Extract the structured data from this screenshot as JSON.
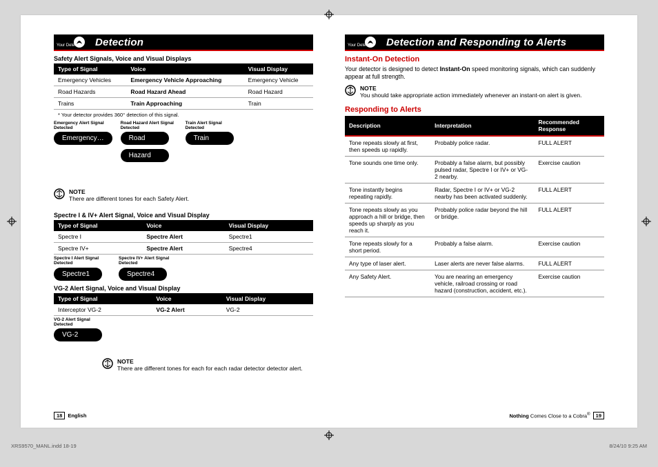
{
  "left": {
    "your_detector": "Your Detector",
    "title": "Detection",
    "t1_caption": "Safety Alert Signals, Voice and Visual Displays",
    "th": {
      "signal": "Type of Signal",
      "voice": "Voice",
      "visual": "Visual Display"
    },
    "t1": [
      {
        "signal": "Emergency Vehicles",
        "voice": "Emergency Vehicle Approaching",
        "visual": "Emergency Vehicle"
      },
      {
        "signal": "Road Hazards",
        "voice": "Road Hazard Ahead",
        "visual": "Road Hazard"
      },
      {
        "signal": "Trains",
        "voice": "Train Approaching",
        "visual": "Train"
      }
    ],
    "t1_foot": "* Your detector provides 360° detection of this signal.",
    "chips1": [
      {
        "label": "Emergency Alert Signal Detected",
        "chips": [
          "Emergency…"
        ]
      },
      {
        "label": "Road Hazard Alert Signal Detected",
        "chips": [
          "Road",
          "Hazard"
        ]
      },
      {
        "label": "Train Alert Signal Detected",
        "chips": [
          "Train"
        ]
      }
    ],
    "note1_title": "NOTE",
    "note1_body": "There are different tones for each Safety Alert.",
    "t2_caption": "Spectre I & IV+ Alert Signal, Voice and Visual Display",
    "t2": [
      {
        "signal": "Spectre I",
        "voice": "Spectre Alert",
        "visual": "Spectre1"
      },
      {
        "signal": "Spectre IV+",
        "voice": "Spectre Alert",
        "visual": "Spectre4"
      }
    ],
    "chips2": [
      {
        "label": "Spectre I Alert Signal Detected",
        "chips": [
          "Spectre1"
        ]
      },
      {
        "label": "Spectre IV+ Alert Signal Detected",
        "chips": [
          "Spectre4"
        ]
      }
    ],
    "t3_caption": "VG-2 Alert Signal, Voice and Visual Display",
    "t3": [
      {
        "signal": "Interceptor VG-2",
        "voice": "VG-2 Alert",
        "visual": "VG-2"
      }
    ],
    "chips3": [
      {
        "label": "VG-2 Alert Signal Detected",
        "chips": [
          "VG-2"
        ]
      }
    ],
    "note2_title": "NOTE",
    "note2_body": "There are different tones for each for each radar detector detector alert.",
    "page_num": "18",
    "page_lang": "English"
  },
  "right": {
    "your_detector": "Your Detector",
    "title": "Detection and Responding to Alerts",
    "h_instant": "Instant-On Detection",
    "p_instant_a": "Your detector is designed to detect ",
    "p_instant_b": "Instant-On",
    "p_instant_c": " speed monitoring signals, which can suddenly appear at full strength.",
    "note_title": "NOTE",
    "note_body": "You should take appropriate action immediately whenever an instant-on alert is given.",
    "h_resp": "Responding to Alerts",
    "th": {
      "desc": "Description",
      "interp": "Interpretation",
      "rec": "Recommended Response"
    },
    "rows": [
      {
        "desc": "Tone repeats slowly at first, then speeds up rapidly.",
        "interp": "Probably police radar.",
        "rec": "FULL ALERT"
      },
      {
        "desc": "Tone sounds one time only.",
        "interp": "Probably a false alarm, but possibly pulsed radar, Spectre I or IV+ or VG-2 nearby.",
        "rec": "Exercise caution"
      },
      {
        "desc": "Tone instantly begins repeating rapidly.",
        "interp": "Radar, Spectre I or IV+ or VG-2 nearby has been activated suddenly.",
        "rec": "FULL ALERT"
      },
      {
        "desc": "Tone repeats slowly as you approach a hill or bridge, then speeds up sharply as you reach it.",
        "interp": "Probably police radar beyond the hill or bridge.",
        "rec": "FULL ALERT"
      },
      {
        "desc": "Tone repeats slowly for a short period.",
        "interp": "Probably a false alarm.",
        "rec": "Exercise caution"
      },
      {
        "desc": "Any type of laser alert.",
        "interp": "Laser alerts are never false alarms.",
        "rec": "FULL ALERT"
      },
      {
        "desc": "Any Safety Alert.",
        "interp": "You are nearing an emergency vehicle, railroad crossing or road hazard (construction, accident, etc.).",
        "rec": "Exercise caution"
      }
    ],
    "footer_tag_a": "Nothing",
    "footer_tag_b": " Comes Close to a Cobra",
    "footer_tag_c": "®",
    "page_num": "19"
  },
  "slug": {
    "file": "XRS9570_MANL.indd   18-19",
    "date": "8/24/10   9:25 AM"
  },
  "colorbar": [
    "#ffe100",
    "#e2007a",
    "#009ee0",
    "#000",
    "#e30613",
    "#009640",
    "#0055a4",
    "#fff"
  ]
}
